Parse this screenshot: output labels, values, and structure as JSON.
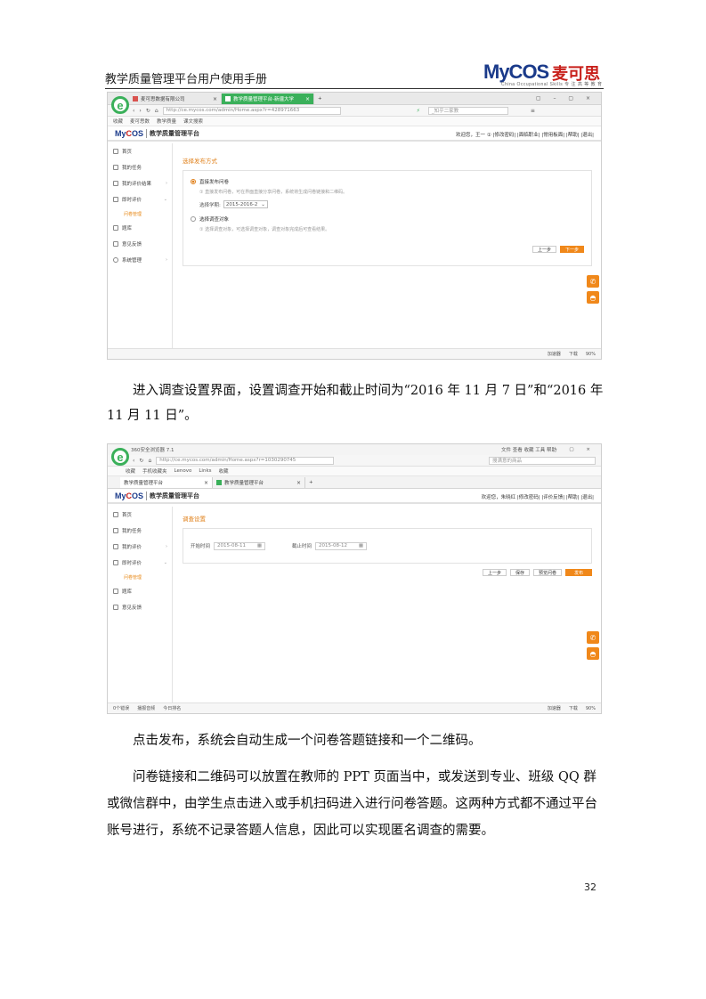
{
  "doc_header": {
    "title": "教学质量管理平台用户使用手册",
    "logo_text": "MyCOS",
    "logo_cn": "麦可思",
    "logo_tagline": "China Occupational Skills  专 注 高 等 教 育"
  },
  "screenshot1": {
    "tabs": [
      {
        "label": "麦可思数据有限公司"
      },
      {
        "label": "教学质量管理平台-新疆大学"
      }
    ],
    "url": "http://ce.mycos.com/admin/Home.aspx?r=428971663",
    "search_placeholder": "_知乎二家教",
    "favorites": [
      "收藏",
      "麦可思数",
      "教学质量",
      "课文搜索"
    ],
    "app_title": "教学质量管理平台",
    "header_links": "欢迎您，王一 ①   |修改密码|  |面临职业|  |常用板面|  |帮助|  |退出|",
    "sidebar": [
      {
        "label": "首页"
      },
      {
        "label": "我的任务"
      },
      {
        "label": "我的评价结果"
      },
      {
        "label": "即时评价"
      },
      {
        "label": "题库"
      },
      {
        "label": "意见反馈"
      },
      {
        "label": "系统管理"
      }
    ],
    "sidebar_sub": "问卷管理",
    "section_title": "选择发布方式",
    "option1": {
      "label": "直接发布问卷",
      "hint": "①  直接发布问卷，可在界面直接分享问卷，系统将生成问卷链接和二维码。",
      "term_label": "选择学期:",
      "term_value": "2015-2016-2"
    },
    "option2": {
      "label": "选择调查对象",
      "hint": "①  选择调查对象，可选择调查对象，调查对象完成后可查看结果。"
    },
    "btn_prev": "上一步",
    "btn_next": "下一步",
    "status_items": [
      "加速器",
      "下载",
      "90%"
    ]
  },
  "para1": "进入调查设置界面，设置调查开始和截止时间为“2016 年 11 月 7 日”和“2016 年 11 月 11 日”。",
  "screenshot2": {
    "window_title": "360安全浏览器 7.1",
    "window_menu": "文件  查看  收藏  工具  帮助",
    "url": "http://ce.mycos.com/admin/Home.aspx?r=1030290745",
    "search_placeholder": "搜满意的商品",
    "favorites": [
      "收藏",
      "手机收藏夹",
      "Lenovo",
      "Links",
      "收藏"
    ],
    "tabs": [
      {
        "label": "教学质量管理平台"
      },
      {
        "label": "教学质量管理平台"
      }
    ],
    "app_title": "教学质量管理平台",
    "header_links": "欢迎您，朱晓红  |修改密码|  |评价反馈|  |帮助|  |退出|",
    "sidebar": [
      {
        "label": "首页"
      },
      {
        "label": "我的任务"
      },
      {
        "label": "我的评价"
      },
      {
        "label": "即时评价"
      },
      {
        "label": "题库"
      },
      {
        "label": "意见反馈"
      }
    ],
    "sidebar_sub": "问卷管理",
    "section_title": "调查设置",
    "start_label": "开始时间",
    "start_value": "2015-08-11",
    "end_label": "截止时间",
    "end_value": "2015-08-12",
    "btn_prev": "上一步",
    "btn_save": "保存",
    "btn_preview": "预览问卷",
    "btn_publish": "发布",
    "status_left": [
      "0个错误",
      "播报音频",
      "今日排名"
    ],
    "status_items": [
      "加速器",
      "下载",
      "90%"
    ]
  },
  "para2": "点击发布，系统会自动生成一个问卷答题链接和一个二维码。",
  "para3": "问卷链接和二维码可以放置在教师的 PPT 页面当中，或发送到专业、班级 QQ 群或微信群中，由学生点击进入或手机扫码进入进行问卷答题。这两种方式都不通过平台账号进行，系统不记录答题人信息，因此可以实现匿名调查的需要。",
  "page_number": "32",
  "colors": {
    "accent_orange": "#f0881a",
    "browser_green": "#3ab05a",
    "brand_blue": "#1a3a8a",
    "brand_red": "#c8201b"
  }
}
